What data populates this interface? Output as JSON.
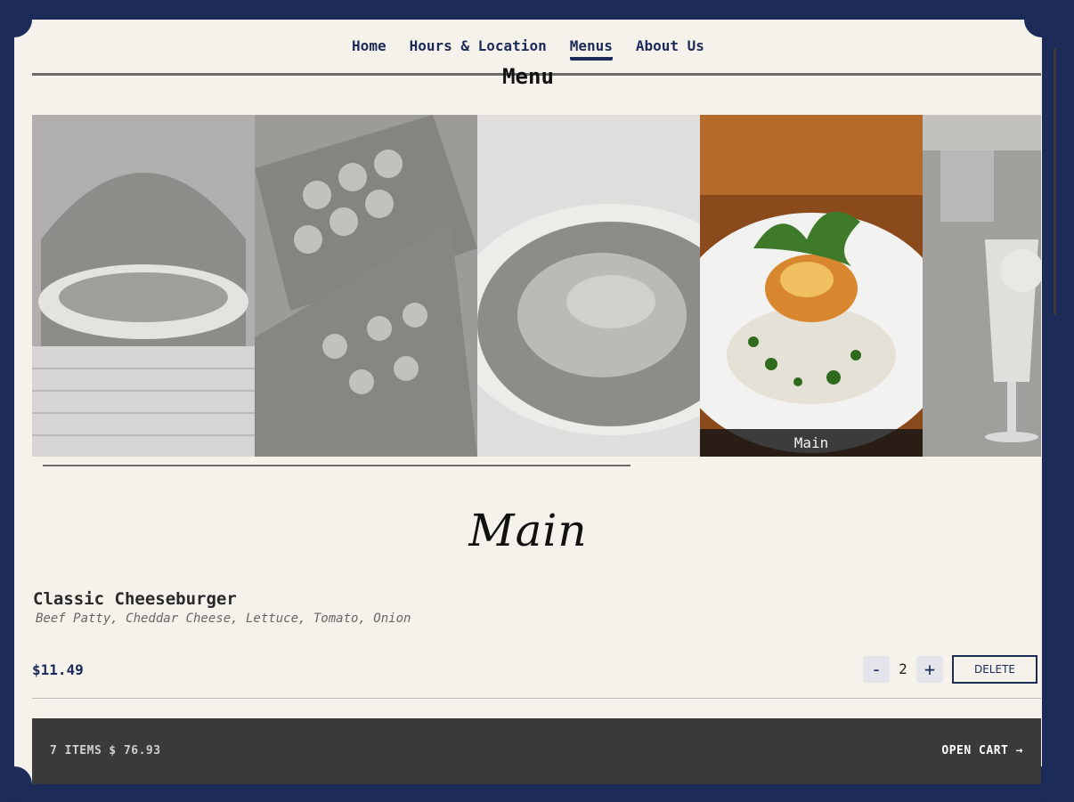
{
  "nav": {
    "items": [
      {
        "label": "Home",
        "active": false
      },
      {
        "label": "Hours & Location",
        "active": false
      },
      {
        "label": "Menus",
        "active": true
      },
      {
        "label": "About Us",
        "active": false
      }
    ]
  },
  "page_title": "Menu",
  "carousel": {
    "cards": [
      {
        "label": "",
        "active": false,
        "icon": "pizza-oven-photo"
      },
      {
        "label": "",
        "active": false,
        "icon": "appetizer-photo"
      },
      {
        "label": "",
        "active": false,
        "icon": "salad-photo"
      },
      {
        "label": "Main",
        "active": true,
        "icon": "main-dish-photo"
      },
      {
        "label": "",
        "active": false,
        "icon": "drink-photo"
      }
    ]
  },
  "section_title": "Main",
  "item": {
    "name": "Classic Cheeseburger",
    "description": "Beef Patty, Cheddar Cheese, Lettuce, Tomato, Onion",
    "price": "$11.49",
    "quantity": "2",
    "minus_label": "-",
    "plus_label": "+",
    "delete_label": "DELETE"
  },
  "cart": {
    "count": "7 ITEMS",
    "total": "$ 76.93",
    "open_label": "OPEN CART →"
  },
  "colors": {
    "navy": "#1c2b57",
    "paper": "#f5f2ec",
    "cart_bar": "#3a3a3a"
  }
}
